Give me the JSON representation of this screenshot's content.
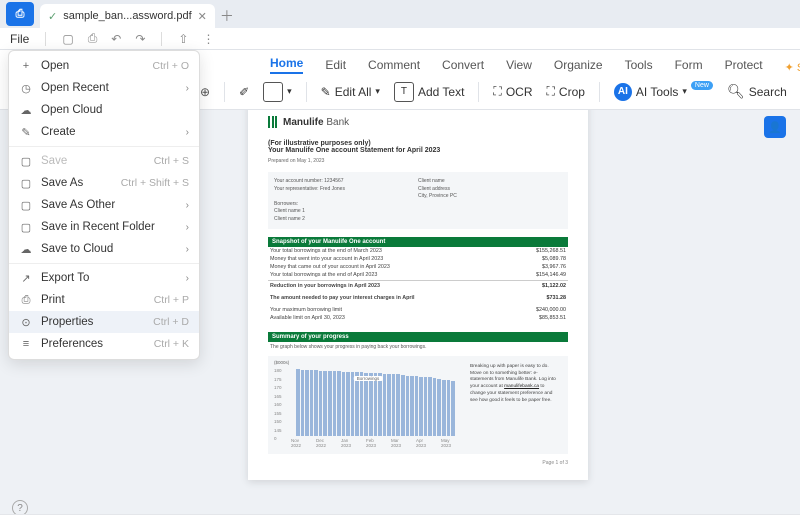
{
  "tab": {
    "title": "sample_ban...assword.pdf",
    "check": true
  },
  "quickbar": {
    "file": "File"
  },
  "ribbon": {
    "tabs": [
      "Home",
      "Edit",
      "Comment",
      "Convert",
      "View",
      "Organize",
      "Tools",
      "Form",
      "Protect"
    ],
    "active": 0,
    "starred": "S..."
  },
  "tools": {
    "edit_all": "Edit All",
    "add_text": "Add Text",
    "ocr": "OCR",
    "crop": "Crop",
    "ai_tools": "AI Tools",
    "new_badge": "New",
    "search": "Search"
  },
  "menu": {
    "items": [
      {
        "icon": "+",
        "label": "Open",
        "shortcut": "Ctrl + O"
      },
      {
        "icon": "◷",
        "label": "Open Recent",
        "sub": true
      },
      {
        "icon": "☁",
        "label": "Open Cloud"
      },
      {
        "icon": "✎",
        "label": "Create",
        "sub": true
      },
      {
        "sep": true
      },
      {
        "icon": "▢",
        "label": "Save",
        "shortcut": "Ctrl + S",
        "disabled": true
      },
      {
        "icon": "▢",
        "label": "Save As",
        "shortcut": "Ctrl + Shift + S"
      },
      {
        "icon": "▢",
        "label": "Save As Other",
        "sub": true
      },
      {
        "icon": "▢",
        "label": "Save in Recent Folder",
        "sub": true
      },
      {
        "icon": "☁",
        "label": "Save to Cloud",
        "sub": true
      },
      {
        "sep": true
      },
      {
        "icon": "↗",
        "label": "Export To",
        "sub": true
      },
      {
        "icon": "⎙",
        "label": "Print",
        "shortcut": "Ctrl + P"
      },
      {
        "icon": "⊙",
        "label": "Properties",
        "shortcut": "Ctrl + D",
        "highlight": true
      },
      {
        "icon": "≡",
        "label": "Preferences",
        "shortcut": "Ctrl + K"
      }
    ]
  },
  "doc": {
    "brand": "Manulife",
    "brand_sub": "Bank",
    "illustrative": "(For illustrative purposes only)",
    "title": "Your Manulife One account Statement for April 2023",
    "prepared": "Prepared on May 1, 2023",
    "info_left": [
      "Your account number: 1234567",
      "Your representative: Fred Jones",
      "",
      "Borrowers:",
      "Client name 1",
      "Client name 2"
    ],
    "info_right": [
      "Client name",
      "Client address",
      "City, Province PC"
    ],
    "snapshot_header": "Snapshot of your Manulife One account",
    "snap_rows": [
      {
        "lbl": "Your total borrowings at the end of March 2023",
        "val": "$155,268.51"
      },
      {
        "lbl": "Money that went into your account in April 2023",
        "val": "$5,089.78"
      },
      {
        "lbl": "Money that came out of your account in April 2023",
        "val": "$3,967.76"
      },
      {
        "lbl": "Your total borrowings at the end of April 2023",
        "val": "$154,146.49"
      },
      {
        "lbl": "Reduction in your borrowings in April 2023",
        "val": "$1,122.02",
        "bold": true,
        "hr": true
      },
      {
        "lbl": "The amount needed to pay your interest charges in April",
        "val": "$731.28",
        "bold": true,
        "sp": true
      },
      {
        "lbl": "Your maximum borrowing limit",
        "val": "$240,000.00",
        "sp": true
      },
      {
        "lbl": "Available limit on April 30, 2023",
        "val": "$85,853.51"
      }
    ],
    "summary_header": "Summary of your progress",
    "summary_text": "The graph below shows your progress in paying back your borrowings.",
    "sidebox": {
      "l1": "Breaking up with paper is easy to do.",
      "l2": "Move on to something better: e-statements from Manulife Bank. Log into your account at ",
      "link": "manulifebank.ca",
      "l3": " to change your statement preference and see how good it feels to be paper free."
    },
    "page_num": "Page 1 of 3"
  },
  "chart_data": {
    "type": "area",
    "title": "($000s)",
    "legend": "Borrowings",
    "ylabel": "",
    "ylim": [
      0,
      180
    ],
    "y_ticks": [
      180,
      175,
      170,
      165,
      160,
      155,
      150,
      145,
      0
    ],
    "categories": [
      "Nov 2022",
      "Dec 2022",
      "Jan 2023",
      "Feb 2023",
      "Mar 2023",
      "Apr 2023",
      "May 2023"
    ],
    "values": [
      178,
      176,
      175,
      174,
      174,
      173,
      172,
      172,
      171,
      171,
      170,
      170,
      170,
      170,
      169,
      168,
      168,
      167,
      166,
      165,
      164,
      164,
      163,
      162,
      160,
      159,
      158,
      157,
      156,
      155,
      154,
      150,
      148,
      147,
      146,
      0
    ]
  }
}
